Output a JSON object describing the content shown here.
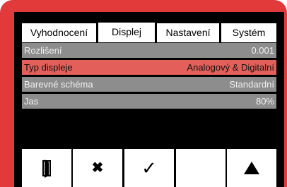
{
  "tabs": [
    {
      "label": "Vyhodnocení"
    },
    {
      "label": "Displej",
      "active": true
    },
    {
      "label": "Nastavení"
    },
    {
      "label": "Systém"
    }
  ],
  "settings": [
    {
      "label": "Rozlišení",
      "value": "0.001"
    },
    {
      "label": "Typ displeje",
      "value": "Analogový & Digitalní",
      "selected": true
    },
    {
      "label": "Barevné schéma",
      "value": "Standardní"
    },
    {
      "label": "Jas",
      "value": "80%"
    }
  ],
  "buttons": [
    {
      "icon": "exit-door-icon"
    },
    {
      "icon": "cancel-x-icon",
      "glyph": "✖"
    },
    {
      "icon": "confirm-check-icon",
      "glyph": "✓"
    },
    {
      "icon": "blank"
    },
    {
      "icon": "up-arrow-icon"
    }
  ],
  "colors": {
    "device_frame": "#e23a3b",
    "screen_bg": "#000000",
    "row_bg": "#8d8d8d",
    "row_selected_bg": "#e26059"
  }
}
